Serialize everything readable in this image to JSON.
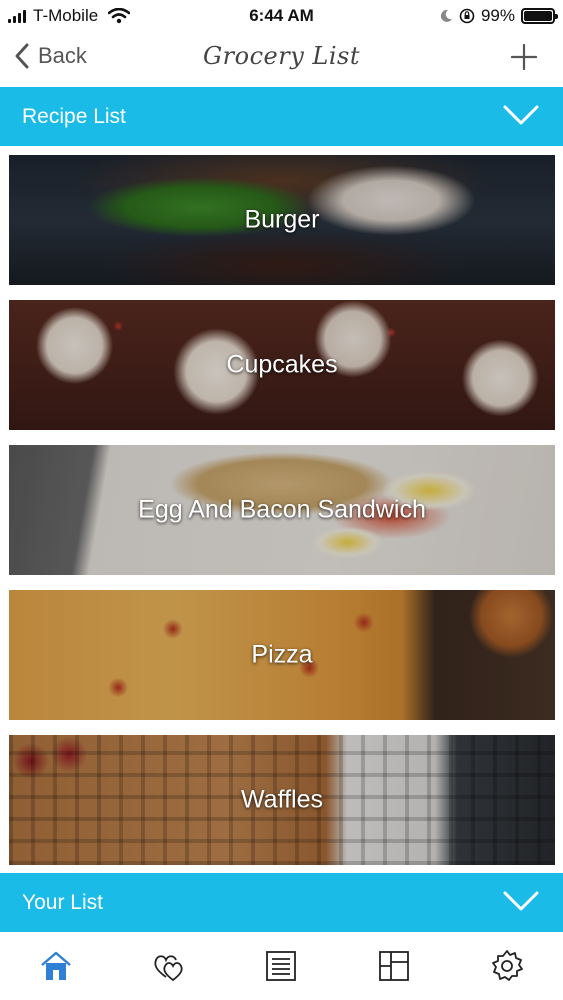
{
  "status": {
    "carrier": "T-Mobile",
    "time": "6:44 AM",
    "battery": "99%",
    "battery_level": 0.99
  },
  "nav": {
    "back_label": "Back",
    "title": "Grocery List",
    "add_icon": "plus-icon"
  },
  "recipe_section": {
    "title": "Recipe List",
    "toggle_icon": "chevron-down-icon"
  },
  "recipes": [
    {
      "label": "Burger"
    },
    {
      "label": "Cupcakes"
    },
    {
      "label": "Egg And Bacon Sandwich"
    },
    {
      "label": "Pizza"
    },
    {
      "label": "Waffles"
    }
  ],
  "your_list_section": {
    "title": "Your List",
    "toggle_icon": "chevron-down-icon"
  },
  "tabs": [
    {
      "icon": "home-icon",
      "active": true
    },
    {
      "icon": "hearts-icon",
      "active": false
    },
    {
      "icon": "list-icon",
      "active": false
    },
    {
      "icon": "layout-grid-icon",
      "active": false
    },
    {
      "icon": "gear-icon",
      "active": false
    }
  ],
  "colors": {
    "accent": "#1bbbe8",
    "tab_active": "#2f7fd6",
    "tab_inactive": "#222222"
  }
}
